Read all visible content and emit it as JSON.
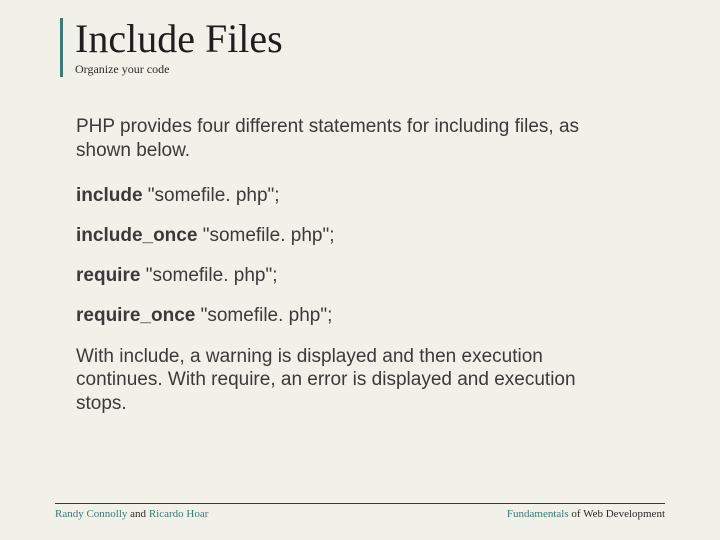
{
  "title": "Include Files",
  "subtitle": "Organize your code",
  "intro": "PHP provides four different statements for including files, as shown below.",
  "statements": [
    {
      "keyword": "include",
      "rest": " \"somefile. php\";"
    },
    {
      "keyword": "include_once",
      "rest": " \"somefile. php\";"
    },
    {
      "keyword": "require",
      "rest": " \"somefile. php\";"
    },
    {
      "keyword": "require_once",
      "rest": " \"somefile. php\";"
    }
  ],
  "outro": "With include, a warning is displayed and then execution continues. With require, an error is displayed and execution stops.",
  "footer": {
    "left_name1": "Randy Connolly",
    "left_and": " and ",
    "left_name2": "Ricardo Hoar",
    "right_word1": "Fundamentals",
    "right_rest": " of Web Development"
  }
}
